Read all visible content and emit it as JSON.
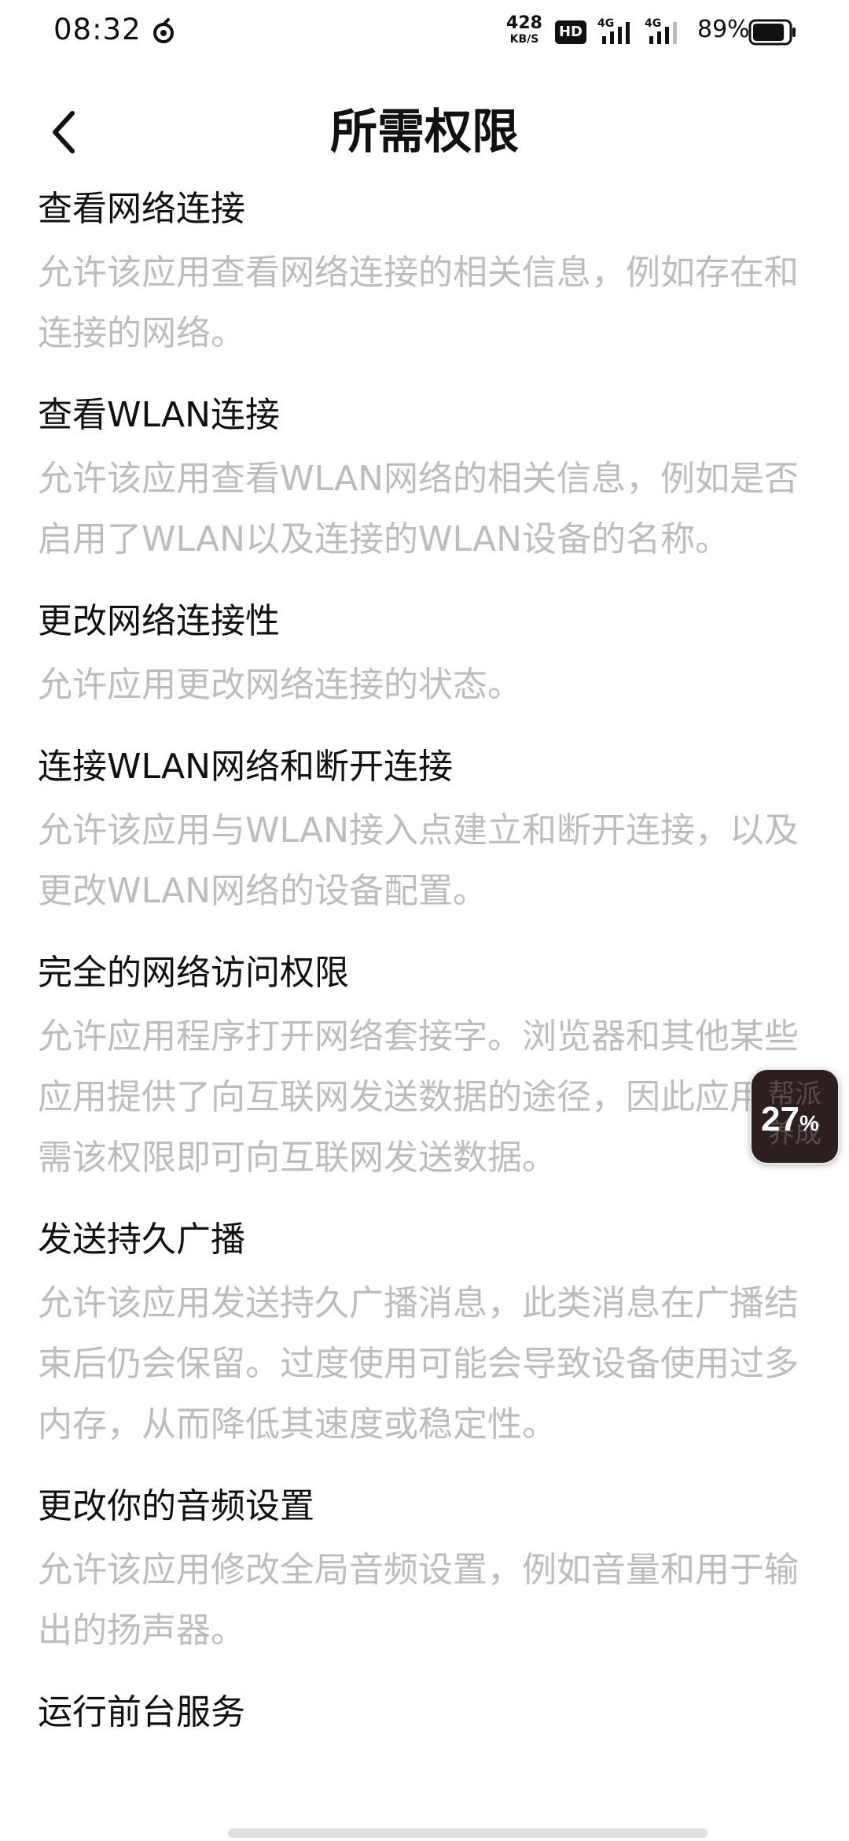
{
  "status_bar": {
    "time": "08:32",
    "net_speed_value": "428",
    "net_speed_unit": "KB/S",
    "hd_label": "HD",
    "signal_1_label": "4G",
    "signal_2_label": "4G",
    "battery_percent": "89%",
    "battery_level": 0.89
  },
  "header": {
    "title": "所需权限",
    "back_icon": "chevron-left-icon"
  },
  "permissions": [
    {
      "title": "查看网络连接",
      "description": "允许该应用查看网络连接的相关信息，例如存在和连接的网络。"
    },
    {
      "title": "查看WLAN连接",
      "description": "允许该应用查看WLAN网络的相关信息，例如是否启用了WLAN以及连接的WLAN设备的名称。"
    },
    {
      "title": "更改网络连接性",
      "description": "允许应用更改网络连接的状态。"
    },
    {
      "title": "连接WLAN网络和断开连接",
      "description": "允许该应用与WLAN接入点建立和断开连接，以及更改WLAN网络的设备配置。"
    },
    {
      "title": "完全的网络访问权限",
      "description": "允许应用程序打开网络套接字。浏览器和其他某些应用提供了向互联网发送数据的途径，因此应用无需该权限即可向互联网发送数据。"
    },
    {
      "title": "发送持久广播",
      "description": "允许该应用发送持久广播消息，此类消息在广播结束后仍会保留。过度使用可能会导致设备使用过多内存，从而降低其速度或稳定性。"
    },
    {
      "title": "更改你的音频设置",
      "description": "允许该应用修改全局音频设置，例如音量和用于输出的扬声器。"
    },
    {
      "title": "运行前台服务",
      "description": ""
    }
  ],
  "float_widget": {
    "bg_text": "帮派养成",
    "value": "27",
    "unit": "%"
  },
  "colors": {
    "title_text": "#111111",
    "description_text": "#bdbdbd",
    "background": "#ffffff",
    "widget_bg": "#2d1f1f"
  }
}
